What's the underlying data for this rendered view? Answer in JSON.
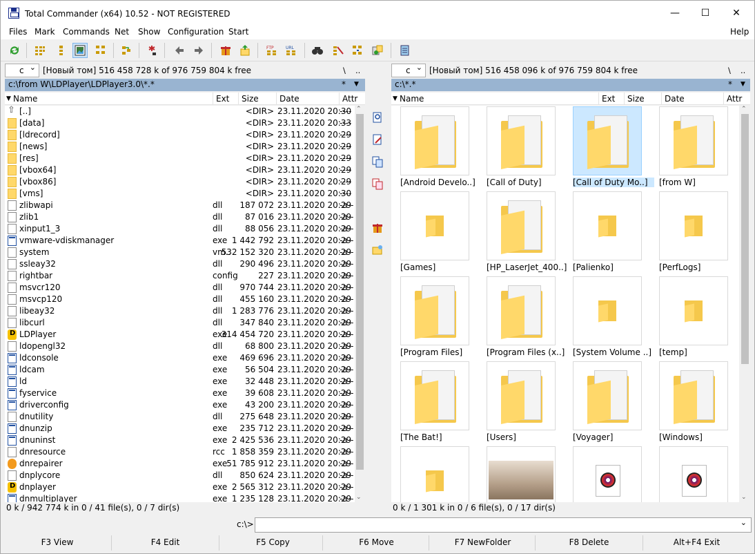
{
  "window": {
    "title": "Total Commander (x64) 10.52 - NOT REGISTERED",
    "minimize": "—",
    "maximize": "☐",
    "close": "✕"
  },
  "menu": [
    "Files",
    "Mark",
    "Commands",
    "Net",
    "Show",
    "Configuration",
    "Start"
  ],
  "menu_help": "Help",
  "toolbar": {
    "icons": [
      "refresh-icon",
      "brief-view-icon",
      "detailed-view-icon",
      "thumbnail-view-icon",
      "tree-view-icon",
      "invert-selection-icon",
      "filter-icon",
      "back-icon",
      "forward-icon",
      "pack-icon",
      "unpack-icon",
      "ftp-connect-icon",
      "url-ftp-icon",
      "search-icon",
      "multi-rename-icon",
      "sync-dirs-icon",
      "compare-icon",
      "notepad-icon"
    ]
  },
  "left": {
    "drive": "c",
    "drive_info": "[Новый том]  516 458 728 k of 976 759 804 k free",
    "root": "\\",
    "up": "..",
    "path": "c:\\from W\\LDPlayer\\LDPlayer3.0\\*.*",
    "star": "*",
    "cols": {
      "name": "Name",
      "ext": "Ext",
      "size": "Size",
      "date": "Date",
      "attr": "Attr"
    },
    "files": [
      {
        "name": "[..]",
        "ext": "",
        "size": "<DIR>",
        "date": "23.11.2020 20:30",
        "attr": "----",
        "icon": "up"
      },
      {
        "name": "[data]",
        "ext": "",
        "size": "<DIR>",
        "date": "23.11.2020 20:33",
        "attr": "----",
        "icon": "fold"
      },
      {
        "name": "[ldrecord]",
        "ext": "",
        "size": "<DIR>",
        "date": "23.11.2020 20:29",
        "attr": "----",
        "icon": "fold"
      },
      {
        "name": "[news]",
        "ext": "",
        "size": "<DIR>",
        "date": "23.11.2020 20:29",
        "attr": "----",
        "icon": "fold"
      },
      {
        "name": "[res]",
        "ext": "",
        "size": "<DIR>",
        "date": "23.11.2020 20:29",
        "attr": "----",
        "icon": "fold"
      },
      {
        "name": "[vbox64]",
        "ext": "",
        "size": "<DIR>",
        "date": "23.11.2020 20:29",
        "attr": "----",
        "icon": "fold"
      },
      {
        "name": "[vbox86]",
        "ext": "",
        "size": "<DIR>",
        "date": "23.11.2020 20:29",
        "attr": "----",
        "icon": "fold"
      },
      {
        "name": "[vms]",
        "ext": "",
        "size": "<DIR>",
        "date": "23.11.2020 20:30",
        "attr": "----",
        "icon": "fold"
      },
      {
        "name": "zlibwapi",
        "ext": "dll",
        "size": "187 072",
        "date": "23.11.2020 20:29",
        "attr": "-a--",
        "icon": "doc"
      },
      {
        "name": "zlib1",
        "ext": "dll",
        "size": "87 016",
        "date": "23.11.2020 20:29",
        "attr": "-a--",
        "icon": "doc"
      },
      {
        "name": "xinput1_3",
        "ext": "dll",
        "size": "88 056",
        "date": "23.11.2020 20:29",
        "attr": "-a--",
        "icon": "doc"
      },
      {
        "name": "vmware-vdiskmanager",
        "ext": "exe",
        "size": "1 442 792",
        "date": "23.11.2020 20:29",
        "attr": "-a--",
        "icon": "exe"
      },
      {
        "name": "system",
        "ext": "vm..",
        "size": "532 152 320",
        "date": "23.11.2020 20:29",
        "attr": "-a--",
        "icon": "doc"
      },
      {
        "name": "ssleay32",
        "ext": "dll",
        "size": "290 496",
        "date": "23.11.2020 20:29",
        "attr": "-a--",
        "icon": "doc"
      },
      {
        "name": "rightbar",
        "ext": "config",
        "size": "227",
        "date": "23.11.2020 20:29",
        "attr": "-a--",
        "icon": "doc"
      },
      {
        "name": "msvcr120",
        "ext": "dll",
        "size": "970 744",
        "date": "23.11.2020 20:29",
        "attr": "-a--",
        "icon": "doc"
      },
      {
        "name": "msvcp120",
        "ext": "dll",
        "size": "455 160",
        "date": "23.11.2020 20:29",
        "attr": "-a--",
        "icon": "doc"
      },
      {
        "name": "libeay32",
        "ext": "dll",
        "size": "1 283 776",
        "date": "23.11.2020 20:29",
        "attr": "-a--",
        "icon": "doc"
      },
      {
        "name": "libcurl",
        "ext": "dll",
        "size": "347 840",
        "date": "23.11.2020 20:29",
        "attr": "-a--",
        "icon": "doc"
      },
      {
        "name": "LDPlayer",
        "ext": "exe",
        "size": "314 454 720",
        "date": "23.11.2020 20:29",
        "attr": "-a--",
        "icon": "ldp"
      },
      {
        "name": "ldopengl32",
        "ext": "dll",
        "size": "68 800",
        "date": "23.11.2020 20:29",
        "attr": "-a--",
        "icon": "doc"
      },
      {
        "name": "ldconsole",
        "ext": "exe",
        "size": "469 696",
        "date": "23.11.2020 20:29",
        "attr": "-a--",
        "icon": "exe"
      },
      {
        "name": "ldcam",
        "ext": "exe",
        "size": "56 504",
        "date": "23.11.2020 20:29",
        "attr": "-a--",
        "icon": "exe"
      },
      {
        "name": "ld",
        "ext": "exe",
        "size": "32 448",
        "date": "23.11.2020 20:29",
        "attr": "-a--",
        "icon": "exe"
      },
      {
        "name": "fyservice",
        "ext": "exe",
        "size": "39 608",
        "date": "23.11.2020 20:29",
        "attr": "-a--",
        "icon": "exe"
      },
      {
        "name": "driverconfig",
        "ext": "exe",
        "size": "43 200",
        "date": "23.11.2020 20:29",
        "attr": "-a--",
        "icon": "exe"
      },
      {
        "name": "dnutility",
        "ext": "dll",
        "size": "275 648",
        "date": "23.11.2020 20:29",
        "attr": "-a--",
        "icon": "doc"
      },
      {
        "name": "dnunzip",
        "ext": "exe",
        "size": "235 712",
        "date": "23.11.2020 20:29",
        "attr": "-a--",
        "icon": "exe"
      },
      {
        "name": "dnuninst",
        "ext": "exe",
        "size": "2 425 536",
        "date": "23.11.2020 20:29",
        "attr": "-a--",
        "icon": "exe"
      },
      {
        "name": "dnresource",
        "ext": "rcc",
        "size": "1 858 359",
        "date": "23.11.2020 20:29",
        "attr": "-a--",
        "icon": "doc"
      },
      {
        "name": "dnrepairer",
        "ext": "exe",
        "size": "51 785 912",
        "date": "23.11.2020 20:29",
        "attr": "-a--",
        "icon": "dnr"
      },
      {
        "name": "dnplycore",
        "ext": "dll",
        "size": "850 624",
        "date": "23.11.2020 20:29",
        "attr": "-a--",
        "icon": "doc"
      },
      {
        "name": "dnplayer",
        "ext": "exe",
        "size": "2 565 312",
        "date": "23.11.2020 20:29",
        "attr": "-a--",
        "icon": "ldp"
      },
      {
        "name": "dnmultiplayer",
        "ext": "exe",
        "size": "1 235 128",
        "date": "23.11.2020 20:29",
        "attr": "-a--",
        "icon": "exe"
      }
    ],
    "status": "0 k / 942 774 k in 0 / 41 file(s), 0 / 7 dir(s)"
  },
  "right": {
    "drive": "c",
    "drive_info": "[Новый том]  516 458 096 k of 976 759 804 k free",
    "root": "\\",
    "up": "..",
    "path": "c:\\*.*",
    "star": "*",
    "cols": {
      "name": "Name",
      "ext": "Ext",
      "size": "Size",
      "date": "Date",
      "attr": "Attr"
    },
    "tiles": [
      {
        "name": "[Android Develo..]",
        "kind": "big",
        "selected": false
      },
      {
        "name": "[Call of Duty]",
        "kind": "big",
        "selected": false
      },
      {
        "name": "[Call of Duty Mo..]",
        "kind": "big",
        "selected": true
      },
      {
        "name": "[from W]",
        "kind": "big",
        "selected": false
      },
      {
        "name": "[Games]",
        "kind": "small",
        "selected": false
      },
      {
        "name": "[HP_LaserJet_400..]",
        "kind": "big",
        "selected": false
      },
      {
        "name": "[Palienko]",
        "kind": "small",
        "selected": false
      },
      {
        "name": "[PerfLogs]",
        "kind": "small",
        "selected": false
      },
      {
        "name": "[Program Files]",
        "kind": "big",
        "selected": false
      },
      {
        "name": "[Program Files (x..]",
        "kind": "big",
        "selected": false
      },
      {
        "name": "[System Volume ..]",
        "kind": "small",
        "selected": false
      },
      {
        "name": "[temp]",
        "kind": "small",
        "selected": false
      },
      {
        "name": "[The Bat!]",
        "kind": "big",
        "selected": false
      },
      {
        "name": "[Users]",
        "kind": "big",
        "selected": false
      },
      {
        "name": "[Voyager]",
        "kind": "big",
        "selected": false
      },
      {
        "name": "[Windows]",
        "kind": "big",
        "selected": false
      },
      {
        "name": "",
        "kind": "small",
        "selected": false
      },
      {
        "name": "",
        "kind": "image",
        "selected": false
      },
      {
        "name": "",
        "kind": "disc",
        "selected": false
      },
      {
        "name": "",
        "kind": "disc",
        "selected": false
      }
    ],
    "status": "0 k / 1 301 k in 0 / 6 file(s), 0 / 17 dir(s)"
  },
  "cmd": {
    "prompt": "c:\\>",
    "value": ""
  },
  "fkeys": [
    "F3 View",
    "F4 Edit",
    "F5 Copy",
    "F6 Move",
    "F7 NewFolder",
    "F8 Delete",
    "Alt+F4 Exit"
  ]
}
